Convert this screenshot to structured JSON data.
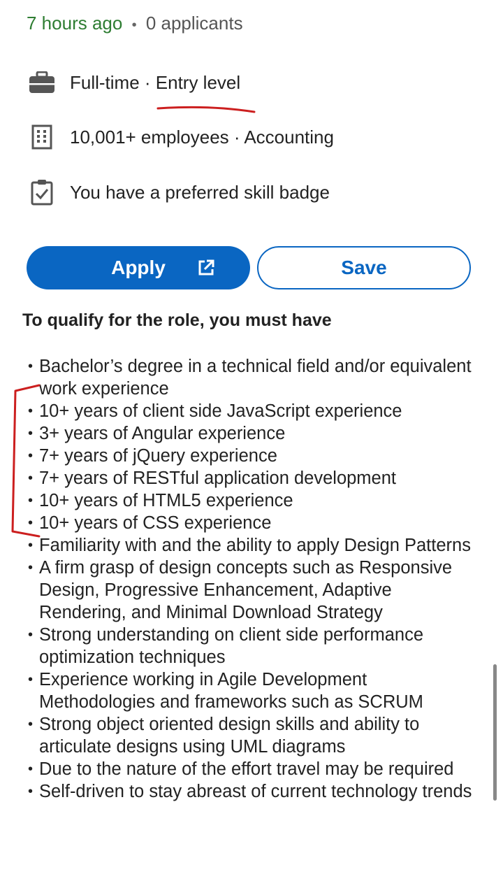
{
  "meta": {
    "posted": "7 hours ago",
    "separator": "•",
    "applicants": "0 applicants"
  },
  "info": [
    {
      "icon": "briefcase-icon",
      "text": "Full-time · Entry level"
    },
    {
      "icon": "building-icon",
      "text": "10,001+ employees · Accounting"
    },
    {
      "icon": "clipboard-check-icon",
      "text": "You have a preferred skill badge"
    }
  ],
  "actions": {
    "apply_label": "Apply",
    "save_label": "Save"
  },
  "qualify": {
    "heading": "To qualify for the role, you must have",
    "items": [
      "Bachelor’s degree in a technical field and/or equivalent work experience",
      "10+ years of client side JavaScript experience",
      "3+ years of Angular experience",
      "7+ years of jQuery experience",
      "7+ years of RESTful application development",
      "10+ years of HTML5 experience",
      "10+ years of CSS experience",
      "Familiarity with and the ability to apply Design Patterns",
      "A firm grasp of design concepts such as Responsive Design, Progressive Enhancement, Adaptive Rendering, and Minimal Download Strategy",
      "Strong understanding on client side performance optimization techniques",
      "Experience working in Agile Development Methodologies and frameworks such as SCRUM",
      "Strong object oriented design skills and ability to articulate designs using UML diagrams",
      "Due to the nature of the effort travel may be required",
      "Self-driven to stay abreast of current technology trends"
    ]
  },
  "colors": {
    "accent": "#0a66c2",
    "time": "#2e7d32",
    "annotation": "#cc1f1f"
  }
}
